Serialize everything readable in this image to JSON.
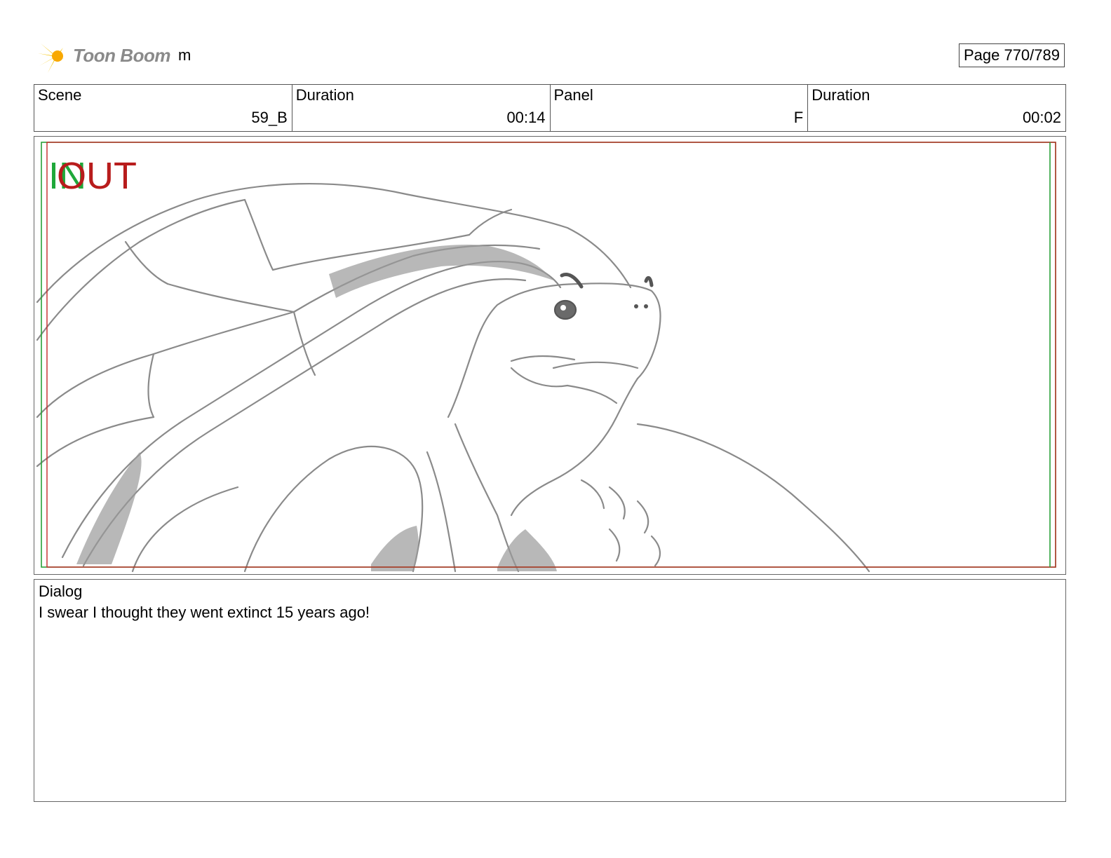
{
  "header": {
    "logo_text": "Toon Boom",
    "project_name": "m",
    "page_indicator": "Page 770/789"
  },
  "info": {
    "scene_label": "Scene",
    "scene_value": "59_B",
    "scene_duration_label": "Duration",
    "scene_duration_value": "00:14",
    "panel_label": "Panel",
    "panel_value": "F",
    "panel_duration_label": "Duration",
    "panel_duration_value": "00:02"
  },
  "panel": {
    "in_marker": "IN",
    "out_marker": "OUT",
    "in_color": "#1fa83a",
    "out_color": "#b81c1c",
    "sketch_subject": "tortoise-sketch"
  },
  "dialog": {
    "label": "Dialog",
    "text": "I swear I thought they went extinct 15 years ago!"
  }
}
